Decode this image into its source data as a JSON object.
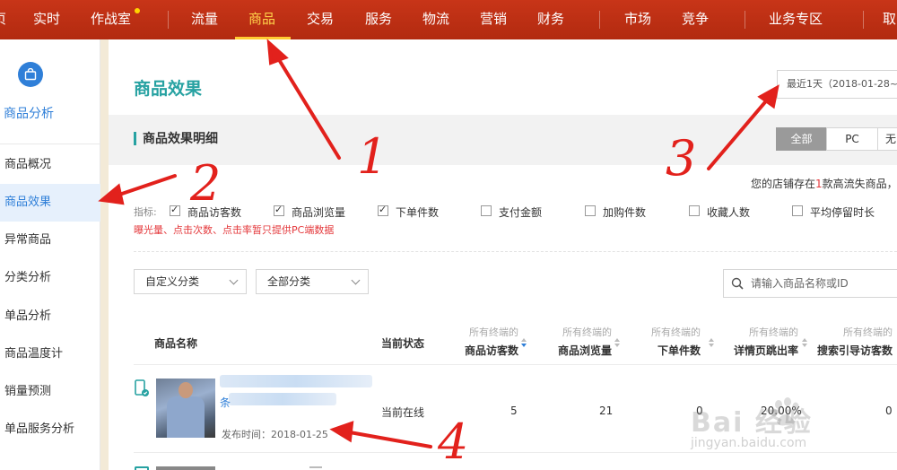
{
  "topnav": {
    "items": [
      "页",
      "实时",
      "作战室",
      "流量",
      "商品",
      "交易",
      "服务",
      "物流",
      "营销",
      "财务",
      "市场",
      "竞争",
      "业务专区",
      "取"
    ],
    "active": "商品"
  },
  "sidebar": {
    "title": "商品分析",
    "items": [
      "商品概况",
      "商品效果",
      "异常商品",
      "分类分析",
      "单品分析",
      "商品温度计",
      "销量预测",
      "单品服务分析"
    ],
    "active": "商品效果"
  },
  "main": {
    "title": "商品效果",
    "date_range": "最近1天（2018-01-28~2",
    "section_title": "商品效果明细",
    "tabs": [
      "全部",
      "PC",
      "无"
    ],
    "store_note_prefix": "您的店铺存在",
    "store_note_count": "1",
    "store_note_suffix": "款高流失商品，",
    "indicator_label": "指标:",
    "indicators": [
      {
        "label": "商品访客数",
        "checked": true
      },
      {
        "label": "商品浏览量",
        "checked": true
      },
      {
        "label": "下单件数",
        "checked": true
      },
      {
        "label": "支付金额",
        "checked": false
      },
      {
        "label": "加购件数",
        "checked": false
      },
      {
        "label": "收藏人数",
        "checked": false
      },
      {
        "label": "平均停留时长",
        "checked": false
      }
    ],
    "warning": "曝光量、点击次数、点击率暂只提供PC端数据",
    "filter1": "自定义分类",
    "filter2": "全部分类",
    "search_placeholder": "请输入商品名称或ID"
  },
  "table": {
    "col_name": "商品名称",
    "col_status": "当前状态",
    "metric_cols": [
      {
        "sub": "所有终端的",
        "main": "商品访客数"
      },
      {
        "sub": "所有终端的",
        "main": "商品浏览量"
      },
      {
        "sub": "所有终端的",
        "main": "下单件数"
      },
      {
        "sub": "所有终端的",
        "main": "详情页跳出率"
      },
      {
        "sub": "所有终端的",
        "main": "搜索引导访客数"
      }
    ],
    "rows": [
      {
        "name_fragment": "条",
        "publish_time": "发布时间：2018-01-25",
        "status": "当前在线",
        "values": [
          "5",
          "21",
          "0",
          "20.00%",
          "0"
        ]
      }
    ]
  },
  "annotations": [
    "1",
    "2",
    "3",
    "4"
  ],
  "watermark": {
    "brand": "Bai 经验",
    "url": "jingyan.baidu.com"
  },
  "colors": {
    "nav_red": "#c0301a",
    "accent_teal": "#27a2a2",
    "link_blue": "#2f7fd8",
    "annotation_red": "#e2211c"
  }
}
